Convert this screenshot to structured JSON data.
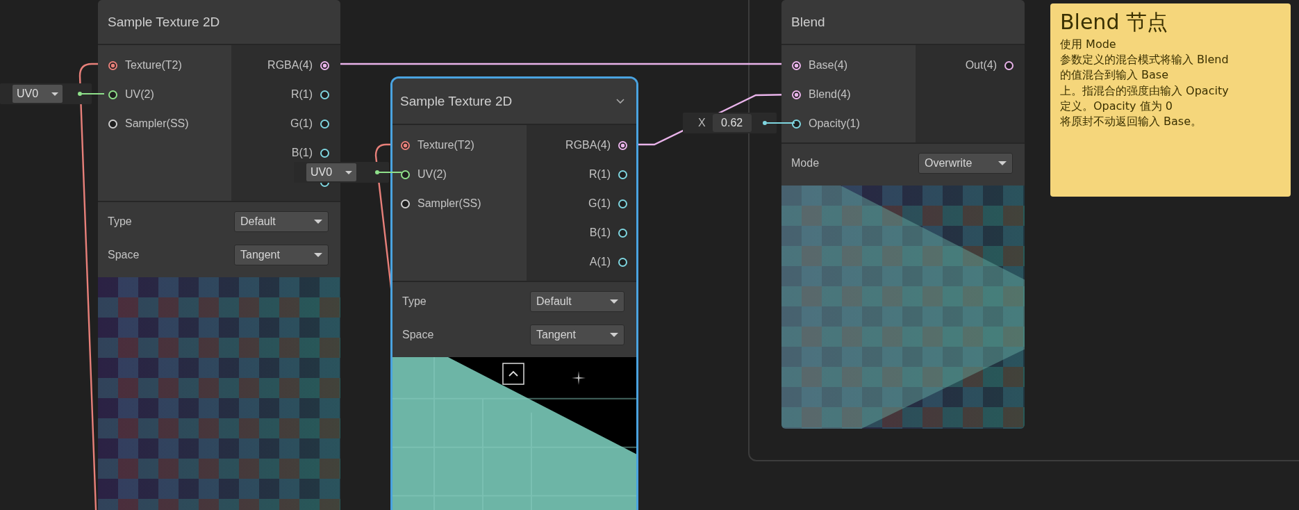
{
  "nodes": [
    {
      "title": "Sample Texture 2D",
      "selected": false,
      "preview": {
        "kind": "checker"
      },
      "inputs": [
        {
          "label": "Texture(T2)",
          "color": "#e8807a",
          "connected": true
        },
        {
          "label": "UV(2)",
          "color": "#8fe08a",
          "connected": false
        },
        {
          "label": "Sampler(SS)",
          "color": "#d0d0d0",
          "connected": false
        }
      ],
      "outputs": [
        {
          "label": "RGBA(4)",
          "color": "#e9b3ea",
          "connected": true
        },
        {
          "label": "R(1)",
          "color": "#7fd6e0",
          "connected": false
        },
        {
          "label": "G(1)",
          "color": "#7fd6e0",
          "connected": false
        },
        {
          "label": "B(1)",
          "color": "#7fd6e0",
          "connected": false
        },
        {
          "color": "#7fd6e0",
          "connected": false
        }
      ],
      "settings": [
        {
          "label": "Type",
          "value": "Default"
        },
        {
          "label": "Space",
          "value": "Tangent"
        }
      ]
    },
    {
      "title": "Sample Texture 2D",
      "selected": true,
      "preview": {
        "kind": "sphere"
      },
      "inputs": [
        {
          "label": "Texture(T2)",
          "color": "#e8807a",
          "connected": true
        },
        {
          "label": "UV(2)",
          "color": "#8fe08a",
          "connected": false
        },
        {
          "label": "Sampler(SS)",
          "color": "#d0d0d0",
          "connected": false
        }
      ],
      "outputs": [
        {
          "label": "RGBA(4)",
          "color": "#e9b3ea",
          "connected": true
        },
        {
          "label": "R(1)",
          "color": "#7fd6e0",
          "connected": false
        },
        {
          "label": "G(1)",
          "color": "#7fd6e0",
          "connected": false
        },
        {
          "label": "B(1)",
          "color": "#7fd6e0",
          "connected": false
        },
        {
          "label": "A(1)",
          "color": "#7fd6e0",
          "connected": false
        }
      ],
      "settings": [
        {
          "label": "Type",
          "value": "Default"
        },
        {
          "label": "Space",
          "value": "Tangent"
        }
      ]
    },
    {
      "title": "Blend",
      "selected": false,
      "preview": {
        "kind": "blend"
      },
      "inputs": [
        {
          "label": "Base(4)",
          "color": "#e9b3ea",
          "connected": true
        },
        {
          "label": "Blend(4)",
          "color": "#e9b3ea",
          "connected": true
        },
        {
          "label": "Opacity(1)",
          "color": "#7fd6e0",
          "connected": false
        }
      ],
      "outputs": [
        {
          "label": "Out(4)",
          "color": "#e9b3ea",
          "connected": false
        }
      ],
      "settings": [
        {
          "label": "Mode",
          "value": "Overwrite"
        }
      ]
    }
  ],
  "inline_inputs": [
    {
      "kind": "dropdown",
      "value": "UV0"
    },
    {
      "kind": "dropdown",
      "value": "UV0"
    },
    {
      "kind": "number",
      "label": "X",
      "value": "0.62"
    }
  ],
  "sticky_note": {
    "title": "Blend 节点",
    "body": "使用 Mode\n参数定义的混合模式将输入 Blend\n的值混合到输入 Base\n上。指混合的强度由输入 Opacity\n定义。Opacity 值为 0\n将原封不动返回输入 Base。"
  }
}
